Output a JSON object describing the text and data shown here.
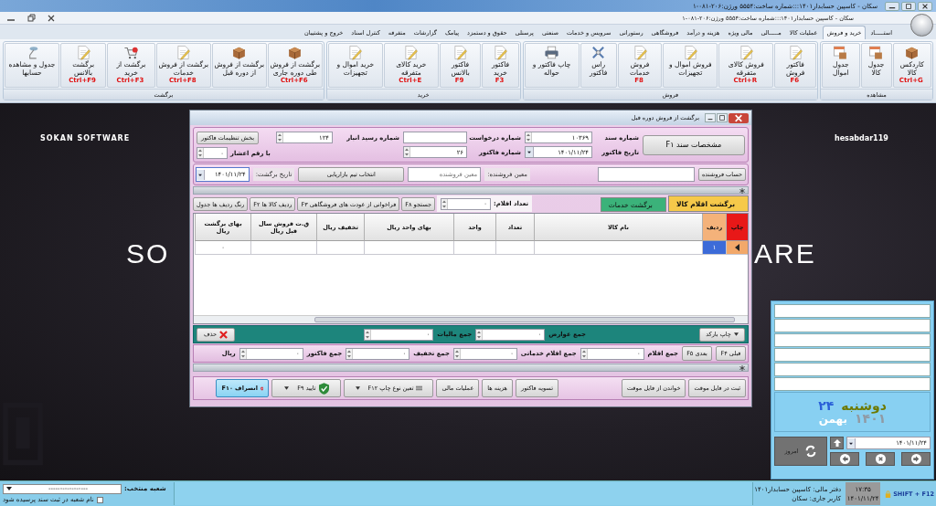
{
  "window": {
    "title": "سکان - کاسپین حسابدار۱۴۰۱:::شماره ساخت:۵۵۵۴  ورژن:۲۰۶-۰۸۱-۱",
    "app_title": "سکان - کاسپین حسابدار۱۴۰۱:::شماره ساخت:۵۵۵۴  ورژن:۲۰۶-۰۸۱-۱"
  },
  "menu_tabs": [
    {
      "label": "استـــــاد",
      "selected": false
    },
    {
      "label": "خرید و فروش",
      "selected": true
    },
    {
      "label": "عملیات کالا",
      "selected": false
    },
    {
      "label": "مـــــالی",
      "selected": false
    },
    {
      "label": "مالی ویژه",
      "selected": false
    },
    {
      "label": "هزینه و درآمد",
      "selected": false
    },
    {
      "label": "فروشگاهی",
      "selected": false
    },
    {
      "label": "رستورانی",
      "selected": false
    },
    {
      "label": "سرویس و خدمات",
      "selected": false
    },
    {
      "label": "صنعتی",
      "selected": false
    },
    {
      "label": "پرسنلی",
      "selected": false
    },
    {
      "label": "حقوق و دستمزد",
      "selected": false
    },
    {
      "label": "پیامک",
      "selected": false
    },
    {
      "label": "گزارشات",
      "selected": false
    },
    {
      "label": "متفرقه",
      "selected": false
    },
    {
      "label": "کنترل اسناد",
      "selected": false
    },
    {
      "label": "خروج و پشتیبان",
      "selected": false
    }
  ],
  "ribbon_groups": [
    {
      "title": "مشاهده",
      "buttons": [
        {
          "label": "کاردکس کالا",
          "shortcut": "Ctrl+G",
          "kind": "box"
        },
        {
          "label": "جدول کالا",
          "kind": "table"
        },
        {
          "label": "جدول اموال",
          "kind": "table"
        }
      ]
    },
    {
      "title": "فروش",
      "buttons": [
        {
          "label": "فاکتور فروش",
          "shortcut": "F6",
          "kind": "doc"
        },
        {
          "label": "فروش کالای متفرقه",
          "shortcut": "Ctrl+R",
          "kind": "doc"
        },
        {
          "label": "فروش اموال و تجهیزات",
          "kind": "doc"
        },
        {
          "label": "فروش خدمات",
          "shortcut": "F8",
          "kind": "doc"
        },
        {
          "label": "راس فاکتور",
          "kind": "tools"
        },
        {
          "label": "چاپ فاکتور و حواله",
          "kind": "printer"
        }
      ]
    },
    {
      "title": "خرید",
      "buttons": [
        {
          "label": "فاکتور خرید",
          "shortcut": "F3",
          "kind": "doc"
        },
        {
          "label": "فاکتور بالانس",
          "shortcut": "F9",
          "kind": "doc"
        },
        {
          "label": "خرید کالای متفرقه",
          "shortcut": "Ctrl+E",
          "kind": "doc"
        },
        {
          "label": "خرید اموال و تجهیزات",
          "kind": "doc"
        }
      ]
    },
    {
      "title": "برگشت",
      "buttons": [
        {
          "label": "برگشت از فروش طی دوره جاری",
          "shortcut": "Ctrl+F6",
          "kind": "box"
        },
        {
          "label": "برگشت از فروش از دوره قبل",
          "kind": "box"
        },
        {
          "label": "برگشت از فروش خدمات",
          "shortcut": "Ctrl+F8",
          "kind": "doc"
        },
        {
          "label": "برگشت از خرید",
          "shortcut": "Ctrl+F3",
          "kind": "cart"
        },
        {
          "label": "برگشت بالانس",
          "shortcut": "Ctrl+F9",
          "kind": "doc"
        },
        {
          "label": "جدول و مشاهده حسابها",
          "kind": "lamp"
        }
      ]
    }
  ],
  "desktop": {
    "brand": "SOKAN SOFTWARE",
    "user": "hesabdar119",
    "big_left": "SO",
    "big_right": "ARE"
  },
  "dialog": {
    "title": "برگشت از فروش دوره قبل",
    "doc_button": "مشخصات سند F۱",
    "header_columns": [
      [
        {
          "label": "شماره سند",
          "value": "۱۰۳۶۹",
          "kind": "spinner"
        },
        {
          "label": "تاریخ فاکتور",
          "value": "۱۴۰۱/۱۱/۲۴",
          "kind": "date"
        }
      ],
      [
        {
          "label": "شماره درخواست",
          "kind": "text"
        },
        {
          "label": "شماره فاکتور",
          "value": "۲۶",
          "kind": "spinner"
        }
      ],
      [
        {
          "label": "شماره رسید انبار",
          "value": "۱۲۴",
          "kind": "spinner"
        }
      ]
    ],
    "settings_button": "بخش تنظیمات فاکتور",
    "decimals": {
      "label": "با رقم اعشار",
      "value": "۰"
    },
    "seller_button": "حساب فروشنده",
    "seller_sub_label": "معین فروشنده:",
    "seller_sub": {
      "placeholder": "معین فروشنده"
    },
    "team_button": "انتخاب تیم بازاریابی",
    "return_date": {
      "label": "تاریخ برگشت:",
      "value": "۱۴۰۱/۱۱/۲۴"
    },
    "tabs": [
      {
        "label": "برگشت اقلام کالا",
        "selected": true,
        "color": "#f6c94a"
      },
      {
        "label": "برگشت خدمات",
        "selected": false,
        "color": "#3bb27a"
      }
    ],
    "item_count": {
      "label": "تعداد اقلام:",
      "value": "۰"
    },
    "tool_buttons": [
      "جستجو F۸",
      "فراخوانی از عودت های فروشگاهی F۳",
      "ردیف کالا ها F۲",
      "رنگ ردیف ها جدول"
    ],
    "columns": [
      {
        "label": "چاپ",
        "kind": "print"
      },
      {
        "label": "ردیف",
        "kind": "index"
      },
      {
        "label": "نام کالا",
        "kind": "text"
      },
      {
        "label": "تعداد",
        "kind": "text"
      },
      {
        "label": "واحد",
        "kind": "text"
      },
      {
        "label": "بهای واحد  ریال",
        "kind": "text"
      },
      {
        "label": "تخفیف  ریال",
        "kind": "text"
      },
      {
        "label": "ق.ت فروش سال قبل ریال",
        "kind": "text"
      },
      {
        "label": "بهای برگشت  ریال",
        "kind": "return_price"
      }
    ],
    "rows": [
      {
        "selected": true,
        "index": "۱",
        "return_price": "۰"
      }
    ],
    "barcode_button": "چاپ بارکد",
    "duties": {
      "label": "جمع عوارض",
      "value": "۰"
    },
    "taxes": {
      "label": "جمع مالیات",
      "value": "۰"
    },
    "delete_button": "حذف",
    "prev_button": "قبلی F۴",
    "next_button": "بعدی F۵",
    "totals": [
      {
        "label": "جمع اقلام",
        "value": "۰"
      },
      {
        "label": "جمع اقلام خدماتی",
        "value": "۰"
      },
      {
        "label": "جمع تخفیف",
        "value": "۰"
      },
      {
        "label": "جمع فاکتور",
        "value": "۰"
      }
    ],
    "currency": "ریال",
    "actions": [
      {
        "label": "ثبت در فایل موقت",
        "kind": "plain",
        "focused": false
      },
      {
        "label": "خواندن از فایل موقت",
        "kind": "plain",
        "focused": false
      },
      {
        "label": "تسویه فاکتور",
        "kind": "plain",
        "focused": false
      },
      {
        "label": "هزینه ها",
        "kind": "plain",
        "focused": false
      },
      {
        "label": "عملیات مالی",
        "kind": "plain",
        "focused": false
      },
      {
        "label": "تعین نوع چاپ F۱۲",
        "kind": "menu",
        "focused": false
      },
      {
        "label": "تایید F۹",
        "kind": "confirm",
        "focused": false
      },
      {
        "label": "انصراف F۱۰",
        "kind": "cancel",
        "focused": true
      }
    ]
  },
  "calendar": {
    "day_name": "دوشنبه",
    "day": "۲۴",
    "month": "بهمن",
    "year": "۱۴۰۱",
    "today_button": "امروز",
    "date": "۱۴۰۱/۱۱/۲۴"
  },
  "status_bar": {
    "branch_label": "شعبه منتخب:",
    "branch_value": "-----------------",
    "ask_branch": {
      "label": "نام شعبه در ثبت سند پرسیده شود",
      "checked": false
    },
    "ledger": "دفتر مالی: کاسپین حسابدار۱۴۰۱",
    "user": "کاربر جاری: سکان",
    "time": "۱۷:۳۵",
    "date": "۱۴۰۱/۱۱/۲۴",
    "lock_hint": "SHIFT + F12"
  }
}
